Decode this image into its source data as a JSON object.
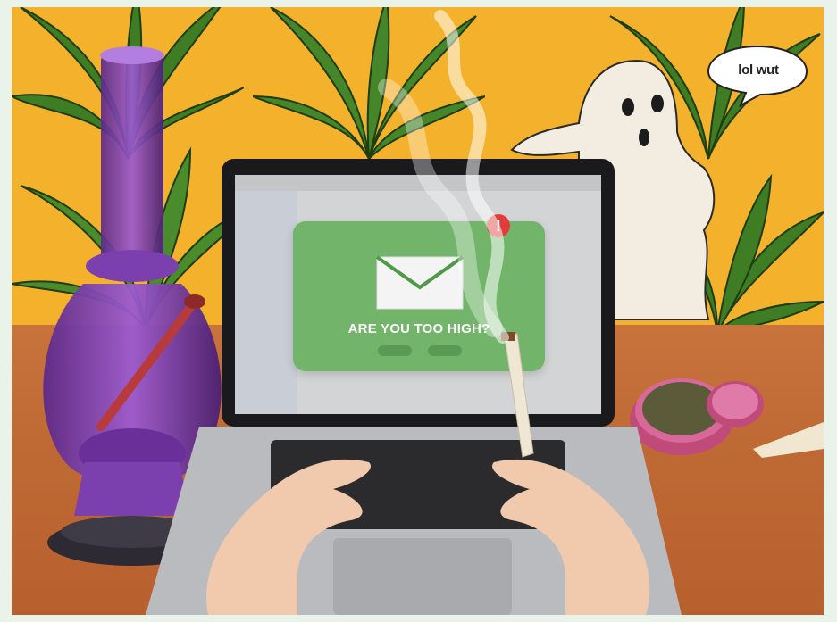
{
  "scene": {
    "popup_text": "ARE YOU TOO HIGH?",
    "alert_symbol": "!",
    "speech_bubble_text": "lol wut"
  },
  "colors": {
    "background_wall": "#f4b12c",
    "table": "#bf6a35",
    "popup_green": "#72b56a",
    "alert_red": "#e13b3b",
    "bong_purple": "#8b4bb8",
    "ghost": "#f3ede1"
  }
}
